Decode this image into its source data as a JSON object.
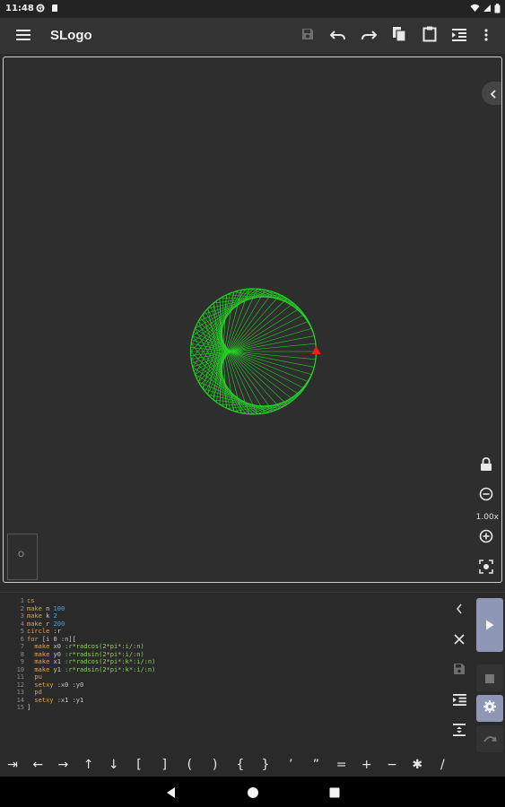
{
  "status": {
    "time": "11:48"
  },
  "app": {
    "title": "SLogo"
  },
  "toolbar": [
    "menu-icon",
    "save-icon",
    "undo-icon",
    "redo-icon",
    "copy-icon",
    "paste-icon",
    "indent-icon",
    "more-icon"
  ],
  "canvas": {
    "zoom": "1.00x",
    "minimap_mark": "O",
    "drawing": {
      "n": 100,
      "k": 2,
      "r": 200,
      "color": "#26d126",
      "turtle_color": "#ff1a1a"
    }
  },
  "editor": {
    "lines": [
      {
        "n": "1",
        "tokens": [
          {
            "t": "cs",
            "c": "kw"
          }
        ]
      },
      {
        "n": "2",
        "tokens": [
          {
            "t": "make ",
            "c": "kw"
          },
          {
            "t": "n ",
            "c": "var"
          },
          {
            "t": "100",
            "c": "num"
          }
        ]
      },
      {
        "n": "3",
        "tokens": [
          {
            "t": "make ",
            "c": "kw"
          },
          {
            "t": "k ",
            "c": "var"
          },
          {
            "t": "2",
            "c": "num"
          }
        ]
      },
      {
        "n": "4",
        "tokens": [
          {
            "t": "make ",
            "c": "kw"
          },
          {
            "t": "r ",
            "c": "var"
          },
          {
            "t": "200",
            "c": "num"
          }
        ]
      },
      {
        "n": "5",
        "tokens": [
          {
            "t": "circle ",
            "c": "kw"
          },
          {
            "t": ":r",
            "c": "var"
          }
        ]
      },
      {
        "n": "6",
        "tokens": [
          {
            "t": "for ",
            "c": "kw"
          },
          {
            "t": "[i 0 :n]",
            "c": "var"
          },
          {
            "t": "[",
            "c": "plain"
          }
        ]
      },
      {
        "n": "7",
        "tokens": [
          {
            "t": "  make ",
            "c": "kw"
          },
          {
            "t": "x0 ",
            "c": "var"
          },
          {
            "t": ":r*radcos(2*pi*:i/:n)",
            "c": "fn"
          }
        ]
      },
      {
        "n": "8",
        "tokens": [
          {
            "t": "  make ",
            "c": "kw"
          },
          {
            "t": "y0 ",
            "c": "var"
          },
          {
            "t": ":r*radsin(2*pi*:i/:n)",
            "c": "fn"
          }
        ]
      },
      {
        "n": "9",
        "tokens": [
          {
            "t": "  make ",
            "c": "kw"
          },
          {
            "t": "x1 ",
            "c": "var"
          },
          {
            "t": ":r*radcos(2*pi*:k*:i/:n)",
            "c": "fn"
          }
        ]
      },
      {
        "n": "10",
        "tokens": [
          {
            "t": "  make ",
            "c": "kw"
          },
          {
            "t": "y1 ",
            "c": "var"
          },
          {
            "t": ":r*radsin(2*pi*:k*:i/:n)",
            "c": "fn"
          }
        ]
      },
      {
        "n": "11",
        "tokens": [
          {
            "t": "  pu",
            "c": "kw"
          }
        ]
      },
      {
        "n": "12",
        "tokens": [
          {
            "t": "  setxy ",
            "c": "kw"
          },
          {
            "t": ":x0 :y0",
            "c": "var"
          }
        ]
      },
      {
        "n": "13",
        "tokens": [
          {
            "t": "  pd",
            "c": "kw"
          }
        ]
      },
      {
        "n": "14",
        "tokens": [
          {
            "t": "  setxy ",
            "c": "kw"
          },
          {
            "t": ":x1 :y1",
            "c": "var"
          }
        ]
      },
      {
        "n": "15",
        "tokens": [
          {
            "t": "]",
            "c": "plain"
          }
        ]
      }
    ]
  },
  "keys": [
    "⇥",
    "←",
    "→",
    "↑",
    "↓",
    "[",
    "]",
    "(",
    ")",
    "{",
    "}",
    "’",
    "”",
    "=",
    "+",
    "−",
    "✱",
    "/"
  ],
  "colors": {
    "accent": "#8e97b5",
    "background": "#2b2b2b",
    "appbar": "#333333"
  }
}
